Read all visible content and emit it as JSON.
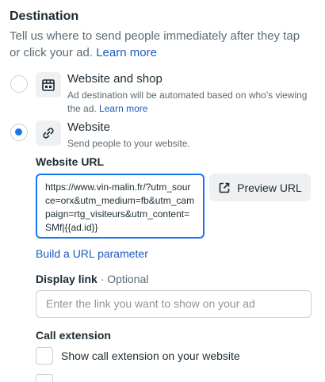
{
  "header": {
    "title": "Destination",
    "subtitle": "Tell us where to send people immediately after they tap or click your ad.",
    "learn_more": "Learn more"
  },
  "options": [
    {
      "title": "Website and shop",
      "description": "Ad destination will be automated based on who's viewing the ad.",
      "learn_more": "Learn more",
      "icon": "shop-icon",
      "selected": false
    },
    {
      "title": "Website",
      "description": "Send people to your website.",
      "icon": "link-icon",
      "selected": true
    }
  ],
  "website_url": {
    "label": "Website URL",
    "value": "https://www.vin-malin.fr/?utm_source=orx&utm_medium=fb&utm_campaign=rtg_visiteurs&utm_content=SMf|{{ad.id}}",
    "preview_button": "Preview URL",
    "build_param_link": "Build a URL parameter"
  },
  "display_link": {
    "label": "Display link",
    "optional": "· Optional",
    "placeholder": "Enter the link you want to show on your ad"
  },
  "call_extension": {
    "label": "Call extension",
    "checkbox_label": "Show call extension on your website",
    "checked": false
  },
  "colors": {
    "accent": "#1877f2",
    "link": "#1b5bbf",
    "text": "#1c2b33",
    "muted": "#5b6b74"
  }
}
